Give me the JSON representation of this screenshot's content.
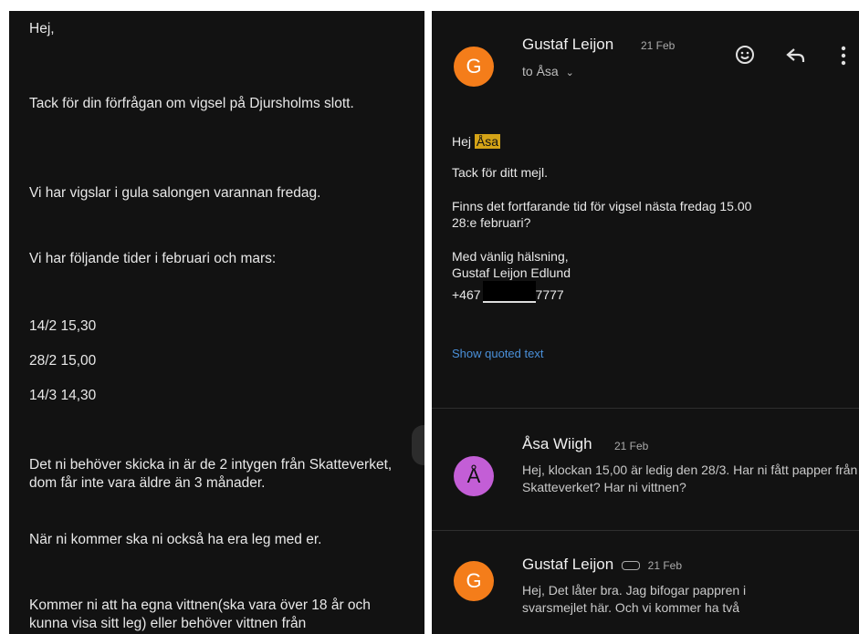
{
  "left_message": {
    "lines": [
      "Hej,",
      "Tack för din förfrågan om vigsel på Djursholms slott.",
      "Vi har vigslar i gula salongen varannan fredag.",
      "Vi har följande tider i februari och mars:",
      "14/2 15,30",
      "28/2 15,00",
      "14/3 14,30",
      "Det ni behöver skicka in är de 2 intygen från Skatteverket, dom får inte vara äldre än 3 månader.",
      "När ni kommer ska ni också ha era leg med er.",
      "Kommer ni att ha egna vittnen(ska vara över 18 år och kunna visa sitt leg) eller behöver vittnen från"
    ]
  },
  "thread": {
    "email1": {
      "avatar_letter": "G",
      "sender": "Gustaf Leijon",
      "date": "21 Feb",
      "to_label": "to Åsa",
      "greeting_prefix": "Hej",
      "greeting_name": "Åsa",
      "line1": "Tack för ditt mejl.",
      "line2": "Finns det fortfarande tid för vigsel nästa fredag 15.00",
      "line3": "28:e februari?",
      "sign1": "Med vänlig hälsning,",
      "sign2": "Gustaf Leijon Edlund",
      "phone_prefix": "+467",
      "phone_suffix": "7777",
      "show_quoted": "Show quoted text"
    },
    "email2": {
      "avatar_letter": "Å",
      "sender": "Åsa Wiigh",
      "date": "21 Feb",
      "snippet": "Hej, klockan 15,00 är ledig den 28/3. Har ni fått papper från Skatteverket? Har ni vittnen?"
    },
    "email3": {
      "avatar_letter": "G",
      "sender": "Gustaf Leijon",
      "date": "21 Feb",
      "snippet": "Hej, Det låter bra. Jag bifogar pappren i svarsmejlet här. Och vi kommer ha två"
    }
  },
  "icons": [
    "emoji-icon",
    "reply-icon",
    "more-vert-icon",
    "chevron-down-icon",
    "attachment-icon"
  ],
  "colors": {
    "background": "#121212",
    "orange_avatar": "#f47d1a",
    "purple_avatar": "#c35ed6",
    "highlight": "#d4a317",
    "link": "#4a90d9"
  }
}
